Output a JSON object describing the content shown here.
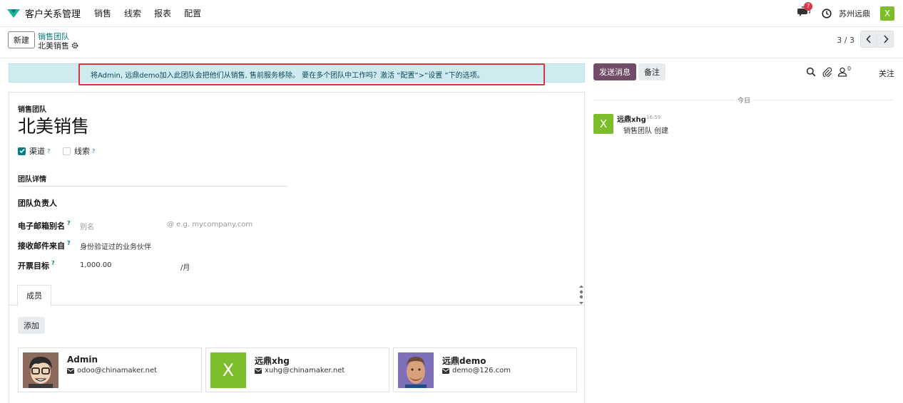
{
  "navbar": {
    "app_name": "客户关系管理",
    "menu": [
      "销售",
      "线索",
      "报表",
      "配置"
    ],
    "message_count": "7",
    "company": "苏州远鼎",
    "user_initial": "X"
  },
  "control": {
    "new_label": "新建",
    "breadcrumb_parent": "销售团队",
    "breadcrumb_current": "北美销售",
    "pager": "3 / 3"
  },
  "alert": {
    "text": "将Admin, 远鼎demo加入此团队会把他们从销售, 售前服务移除。 要在多个团队中工作吗？激活 “配置”>“设置 ”下的选项。"
  },
  "form": {
    "small_label": "销售团队",
    "title": "北美销售",
    "checkboxes": [
      {
        "label": "渠道",
        "checked": true,
        "help": "?"
      },
      {
        "label": "线索",
        "checked": false,
        "help": "?"
      }
    ],
    "section": "团队详情",
    "leader_label": "团队负责人",
    "email_alias_label": "电子邮箱别名",
    "email_alias_placeholder": "别名",
    "email_domain_placeholder": "@ e.g. mycompany.com",
    "accept_from_label": "接收邮件来自",
    "accept_from_value": "身份验证过的业务伙伴",
    "invoice_target_label": "开票目标",
    "invoice_target_value": "1,000.00",
    "invoice_target_unit": "/月",
    "help_mark": "?",
    "tab_members": "成员",
    "add_label": "添加",
    "members": [
      {
        "name": "Admin",
        "email": "odoo@chinamaker.net"
      },
      {
        "name": "远鼎xhg",
        "email": "xuhg@chinamaker.net",
        "initial": "X"
      },
      {
        "name": "远鼎demo",
        "email": "demo@126.com"
      }
    ]
  },
  "chatter": {
    "send_label": "发送消息",
    "note_label": "备注",
    "follower_count": "0",
    "follow_label": "关注",
    "day_label": "今日",
    "message": {
      "initial": "X",
      "author": "远鼎xhg",
      "time": "16:59",
      "body": "销售团队 创建"
    }
  },
  "colors": {
    "primary": "#714b67",
    "accent": "#017e84",
    "alert_bg": "#d0ebf0",
    "alert_border": "#d9343e",
    "avatar_green": "#7cbd2b"
  }
}
